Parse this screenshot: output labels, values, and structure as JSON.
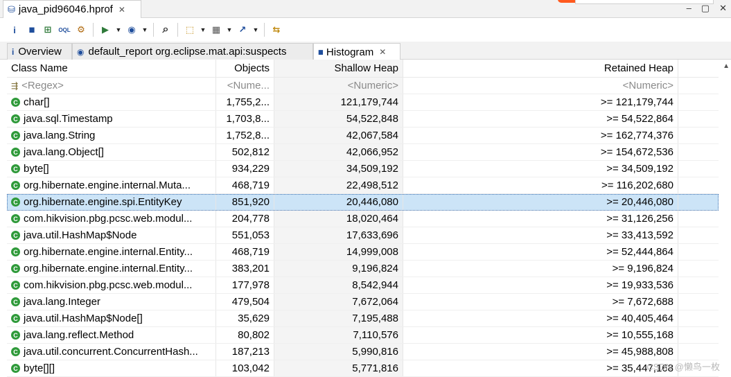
{
  "editor_tab": {
    "title": "java_pid96046.hprof",
    "close": "✕"
  },
  "window_buttons": [
    "‒",
    "▢",
    "✕"
  ],
  "toolbar": {
    "buttons": [
      {
        "icon": "info-icon",
        "glyph": "i"
      },
      {
        "icon": "histogram-icon",
        "glyph": "▮▮"
      },
      {
        "icon": "dominator-tree-icon",
        "glyph": "⊞"
      },
      {
        "icon": "oql-icon",
        "glyph": "OQL"
      },
      {
        "icon": "gear-icon",
        "glyph": "⚙"
      },
      {
        "icon": "run-report-icon",
        "glyph": "▶"
      },
      {
        "icon": "query-browser-icon",
        "glyph": "◉"
      },
      {
        "icon": "search-icon",
        "glyph": "⌕"
      },
      {
        "icon": "group-by-icon",
        "glyph": "⬚"
      },
      {
        "icon": "calculator-icon",
        "glyph": "▦"
      },
      {
        "icon": "export-icon",
        "glyph": "↗"
      },
      {
        "icon": "compare-icon",
        "glyph": "⇆"
      }
    ]
  },
  "view_tabs": [
    {
      "label": "Overview",
      "icon": "i"
    },
    {
      "label": "default_report  org.eclipse.mat.api:suspects",
      "icon": "◉"
    },
    {
      "label": "Histogram",
      "icon": "▮▮",
      "close": "✕"
    }
  ],
  "table": {
    "headers": [
      "Class Name",
      "Objects",
      "Shallow Heap",
      "Retained Heap"
    ],
    "filters": [
      "<Regex>",
      "<Nume...",
      "<Numeric>",
      "<Numeric>"
    ],
    "rows": [
      {
        "name": "char[]",
        "objects": "1,755,2...",
        "shallow": "121,179,744",
        "retained": ">= 121,179,744"
      },
      {
        "name": "java.sql.Timestamp",
        "objects": "1,703,8...",
        "shallow": "54,522,848",
        "retained": ">= 54,522,864"
      },
      {
        "name": "java.lang.String",
        "objects": "1,752,8...",
        "shallow": "42,067,584",
        "retained": ">= 162,774,376"
      },
      {
        "name": "java.lang.Object[]",
        "objects": "502,812",
        "shallow": "42,066,952",
        "retained": ">= 154,672,536"
      },
      {
        "name": "byte[]",
        "objects": "934,229",
        "shallow": "34,509,192",
        "retained": ">= 34,509,192"
      },
      {
        "name": "org.hibernate.engine.internal.Muta...",
        "objects": "468,719",
        "shallow": "22,498,512",
        "retained": ">= 116,202,680"
      },
      {
        "name": "org.hibernate.engine.spi.EntityKey",
        "objects": "851,920",
        "shallow": "20,446,080",
        "retained": ">= 20,446,080"
      },
      {
        "name": "com.hikvision.pbg.pcsc.web.modul...",
        "objects": "204,778",
        "shallow": "18,020,464",
        "retained": ">= 31,126,256"
      },
      {
        "name": "java.util.HashMap$Node",
        "objects": "551,053",
        "shallow": "17,633,696",
        "retained": ">= 33,413,592"
      },
      {
        "name": "org.hibernate.engine.internal.Entity...",
        "objects": "468,719",
        "shallow": "14,999,008",
        "retained": ">= 52,444,864"
      },
      {
        "name": "org.hibernate.engine.internal.Entity...",
        "objects": "383,201",
        "shallow": "9,196,824",
        "retained": ">= 9,196,824"
      },
      {
        "name": "com.hikvision.pbg.pcsc.web.modul...",
        "objects": "177,978",
        "shallow": "8,542,944",
        "retained": ">= 19,933,536"
      },
      {
        "name": "java.lang.Integer",
        "objects": "479,504",
        "shallow": "7,672,064",
        "retained": ">= 7,672,688"
      },
      {
        "name": "java.util.HashMap$Node[]",
        "objects": "35,629",
        "shallow": "7,195,488",
        "retained": ">= 40,405,464"
      },
      {
        "name": "java.lang.reflect.Method",
        "objects": "80,802",
        "shallow": "7,110,576",
        "retained": ">= 10,555,168"
      },
      {
        "name": "java.util.concurrent.ConcurrentHash...",
        "objects": "187,213",
        "shallow": "5,990,816",
        "retained": ">= 45,988,808"
      },
      {
        "name": "byte[][]",
        "objects": "103,042",
        "shallow": "5,771,816",
        "retained": ">= 35,447,168"
      }
    ],
    "selected_index": 6
  },
  "watermark": "CSDN @懒鸟一枚"
}
